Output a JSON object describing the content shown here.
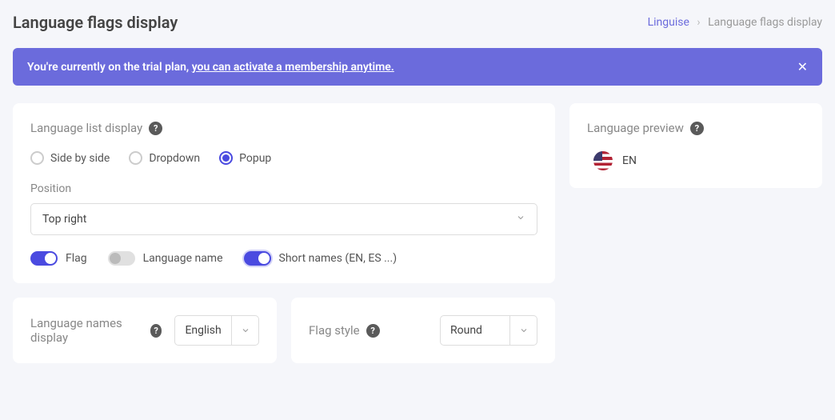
{
  "header": {
    "title": "Language flags display",
    "breadcrumb": {
      "link": "Linguise",
      "current": "Language flags display"
    }
  },
  "banner": {
    "prefix": "You're currently on the trial plan, ",
    "link": "you can activate a membership anytime."
  },
  "list_display": {
    "title": "Language list display",
    "options": {
      "side": "Side by side",
      "dropdown": "Dropdown",
      "popup": "Popup"
    },
    "position_label": "Position",
    "position_value": "Top right",
    "toggles": {
      "flag": "Flag",
      "language_name": "Language name",
      "short_names": "Short names (EN, ES ...)"
    }
  },
  "names_display": {
    "title": "Language names display",
    "value": "English"
  },
  "flag_style": {
    "title": "Flag style",
    "value": "Round"
  },
  "preview": {
    "title": "Language preview",
    "label": "EN"
  }
}
